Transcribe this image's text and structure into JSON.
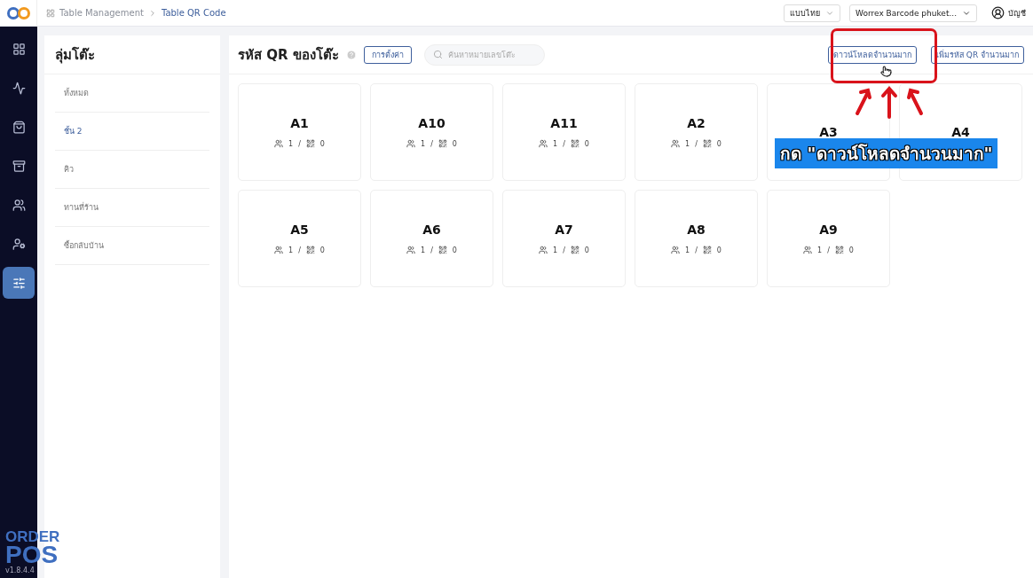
{
  "topbar": {
    "breadcrumb": [
      "Table Management",
      "Table QR Code"
    ],
    "language": "แบบไทย",
    "store": "Worrex Barcode phuket...",
    "account": "บัญชี"
  },
  "nav": [
    {
      "selected": false
    },
    {
      "selected": false
    },
    {
      "selected": false
    },
    {
      "selected": false
    },
    {
      "selected": false
    },
    {
      "selected": false
    },
    {
      "selected": true
    }
  ],
  "brand": {
    "line1": "ORDER",
    "line2": "POS",
    "version": "v1.8.4.4"
  },
  "groups": {
    "title": "ลุ่มโต๊ะ",
    "items": [
      {
        "label": "ทั้งหมด",
        "selected": false
      },
      {
        "label": "ชั้น 2",
        "selected": true
      },
      {
        "label": "คิว",
        "selected": false
      },
      {
        "label": "ทานที่ร้าน",
        "selected": false
      },
      {
        "label": "ซื้อกลับบ้าน",
        "selected": false
      }
    ]
  },
  "main": {
    "title": "รหัส QR ของโต๊ะ",
    "settings_button": "การตั้งค่า",
    "search": {
      "placeholder": "ค้นหาหมายเลขโต๊ะ"
    },
    "download_button": "ดาวน์โหลดจำนวนมาก",
    "add_button": "เพิ่มรหัส QR จำนวนมาก"
  },
  "tables": [
    {
      "name": "A1",
      "seats": "1",
      "separator": "/",
      "qr_count": "0"
    },
    {
      "name": "A10",
      "seats": "1",
      "separator": "/",
      "qr_count": "0"
    },
    {
      "name": "A11",
      "seats": "1",
      "separator": "/",
      "qr_count": "0"
    },
    {
      "name": "A2",
      "seats": "1",
      "separator": "/",
      "qr_count": "0"
    },
    {
      "name": "A3"
    },
    {
      "name": "A4"
    },
    {
      "name": "A5",
      "seats": "1",
      "separator": "/",
      "qr_count": "0"
    },
    {
      "name": "A6",
      "seats": "1",
      "separator": "/",
      "qr_count": "0"
    },
    {
      "name": "A7",
      "seats": "1",
      "separator": "/",
      "qr_count": "0"
    },
    {
      "name": "A8",
      "seats": "1",
      "separator": "/",
      "qr_count": "0"
    },
    {
      "name": "A9",
      "seats": "1",
      "separator": "/",
      "qr_count": "0"
    }
  ],
  "annotation": {
    "text": "กด \"ดาวน์โหลดจำนวนมาก\""
  }
}
